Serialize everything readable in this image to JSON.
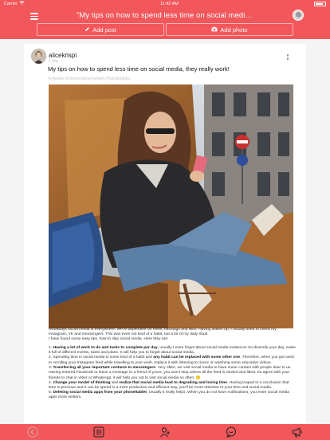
{
  "status_bar": {
    "carrier": "Carrier",
    "time": "11:42 AM",
    "battery": "battery-icon"
  },
  "header": {
    "title": "\"My tips on how to spend less time on social media, they r...",
    "add_post_label": "Add post",
    "add_photo_label": "Add photo"
  },
  "post": {
    "author": "alicekrispi",
    "time": "1 day",
    "title": "My tips on how to spend less time on social media, they really work!",
    "tags": "#Lifestyle  #Contemporarywriters  #Socialmedia",
    "intro": [
      "Nowadays social media is everywhere. We're dependent on news, hashtags and likes. Having waken up, I usually used to check my Instagram, VK and messengers. This was even not kind of a habit, but a bit of my daily ritual.",
      "I have found some easy tips, how to skip social media. Here they are:"
    ],
    "tips": [
      {
        "num": "1.",
        "bold": "Having a lot of work to do and tasks to complete per day",
        "text": ", usually I even forget about social media existence! So diversify your day, make it full of different events, tasks and plans. It will help you to forget about social media."
      },
      {
        "num": "2.",
        "pre": "Spending time in social media is some kind of a habit and ",
        "bold": "any habit can be replaced with some other one",
        "text": ". Therefore, when you got used to scrolling your Instagram feed while travelling to your work, replace it with listening to music or watching some educative videos."
      },
      {
        "num": "3.",
        "bold": "Transferring all your important contacts to messengers",
        "text": ". Very often, we visit social media to have some contact with people dear to us. Having entered Facebook to leave a message to a friend of yours, you won't stop unless all the feed is viewed and liked. So agree with your friends to chat in Viber or WhatsApp, it will help you not to visit social media so often."
      },
      {
        "num": "4.",
        "bold": "Change your model of thinking",
        "mid": " and ",
        "bold2": "realize that social media lead to degrading and losing time",
        "text": ". Having leaped to a conclusion that time is precious and it can be spend in a more productive and efficient way, you'll be more attentive to your time and social media."
      },
      {
        "num": "5.",
        "bold": "Deleting social media apps from your phone/tablet",
        "text": ". Usually it really helps. When you do not have notifications, you enter social media apps more seldom."
      }
    ]
  },
  "bottom_bar": {
    "tabs": [
      "back-icon",
      "feed-icon",
      "add-user-icon",
      "chat-icon",
      "announcement-icon"
    ]
  },
  "colors": {
    "brand": "#f2575b",
    "card": "#ffffff",
    "background": "#f4f4f4"
  }
}
